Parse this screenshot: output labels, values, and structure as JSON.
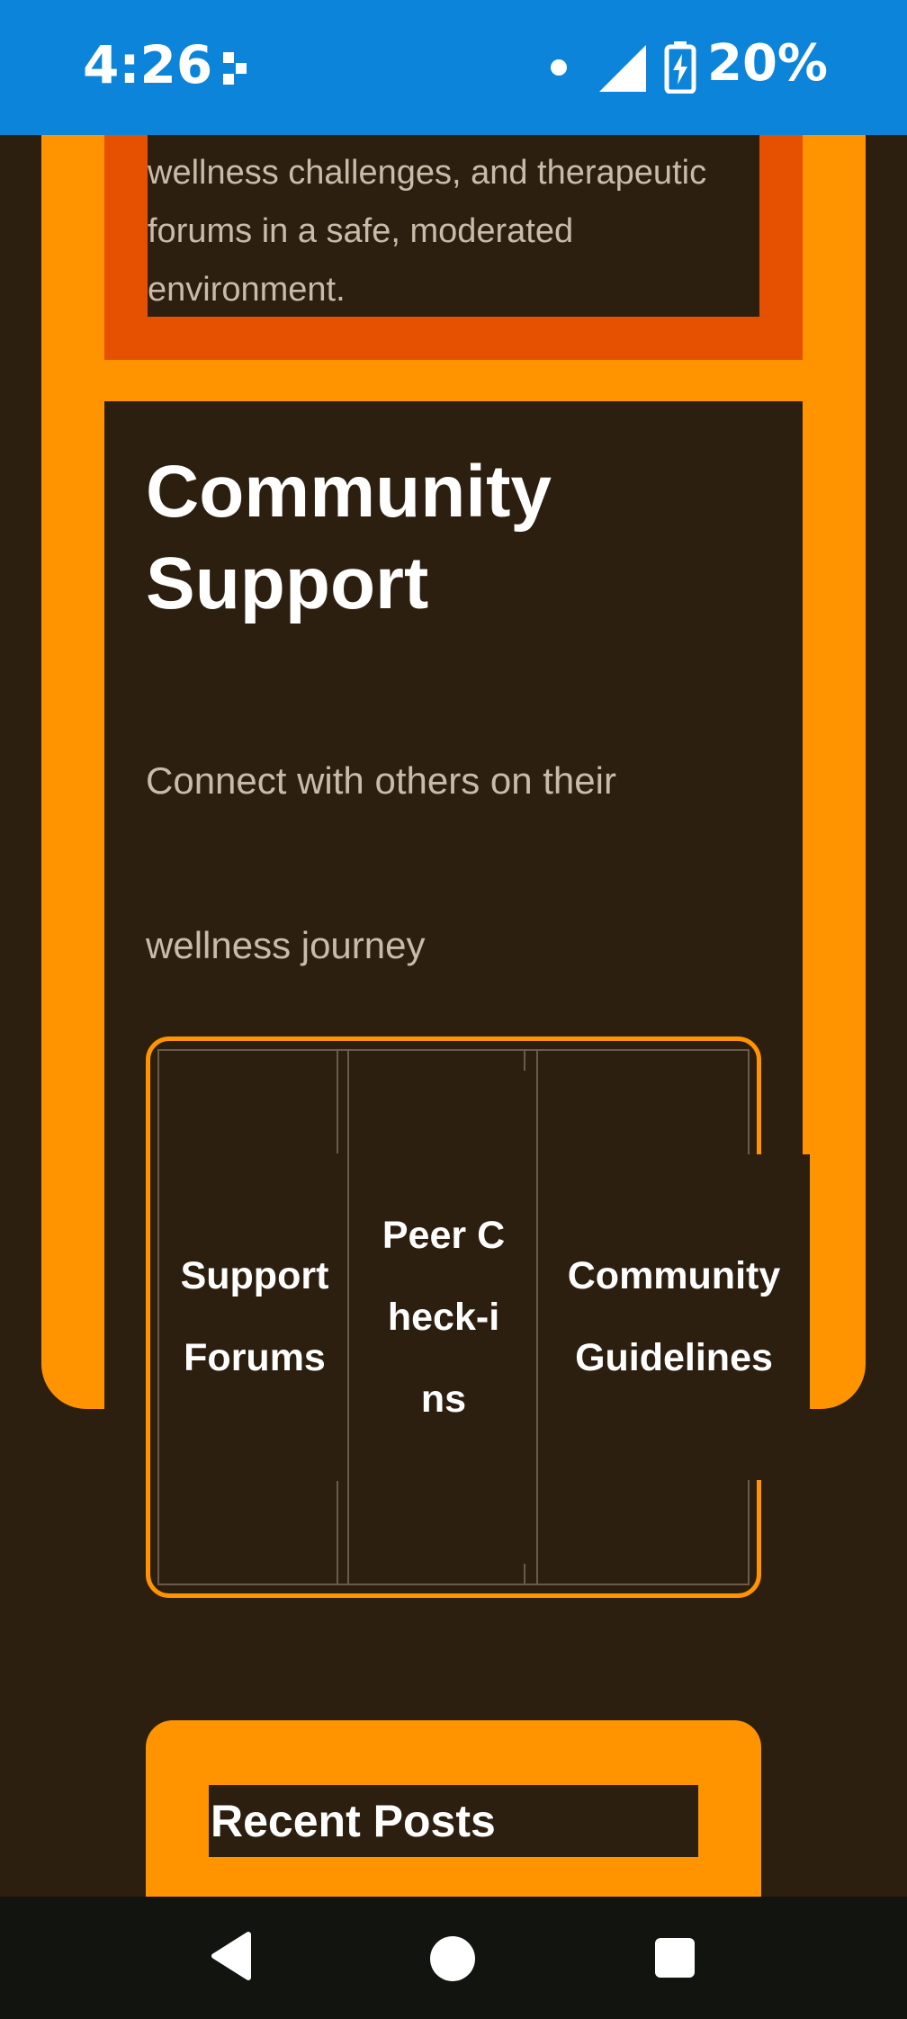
{
  "status_bar": {
    "time": "4:26",
    "battery_percent": "20%",
    "notification_icon": "dots-icon",
    "signal_icon": "signal-icon",
    "battery_icon": "battery-charging-icon"
  },
  "wellness_card": {
    "text": "wellness challenges, and therapeutic forums in a safe, moderated environment."
  },
  "community": {
    "title": "Community Support",
    "description_line1": "Connect with others on their",
    "description_line2": "wellness journey"
  },
  "tabs": [
    {
      "label": "Support Forums"
    },
    {
      "label": "Peer Check-ins"
    },
    {
      "label": "Community Guidelines"
    }
  ],
  "recent_posts": {
    "title": "Recent Posts"
  },
  "colors": {
    "accent_orange": "#ff9400",
    "accent_red": "#e55100",
    "background": "#2d1f10",
    "status_bar": "#0c84da"
  }
}
